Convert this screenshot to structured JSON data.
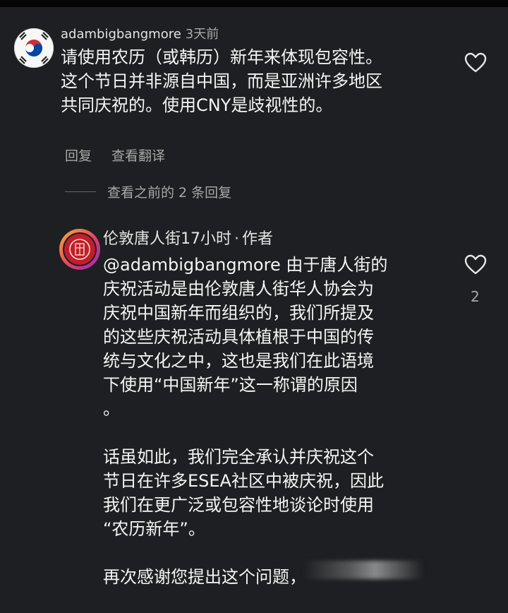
{
  "colors": {
    "background": "#1e1f22",
    "text": "#f2f2f2",
    "muted": "#a8a8a8",
    "korea_flag_red": "#cd2e3a",
    "korea_flag_blue": "#0047a0"
  },
  "comment": {
    "username": "adambigbangmore",
    "time": "3天前",
    "text_lines": [
      "请使用农历（或韩历）新年来体现包容性。",
      "这个节日并非源自中国，而是亚洲许多地区",
      "共同庆祝的。使用CNY是歧视性的。"
    ],
    "avatar_icon": "south-korea-flag-icon",
    "like_icon": "heart-outline-icon"
  },
  "actions": {
    "reply": "回复",
    "translate": "查看翻译"
  },
  "more_replies": "查看之前的 2 条回复",
  "reply": {
    "username": "伦敦唐人街",
    "time": "17小时",
    "separator": "·",
    "author_label": "作者",
    "paragraph1_lines": [
      "@adambigbangmore 由于唐人街的",
      "庆祝活动是由伦敦唐人街华人协会为",
      "庆祝中国新年而组织的，我们所提及",
      "的这些庆祝活动具体植根于中国的传",
      "统与文化之中，这也是我们在此语境",
      "下使用“中国新年”这一称谓的原因",
      "。"
    ],
    "paragraph2_lines": [
      "话虽如此，我们完全承认并庆祝这个",
      "节日在许多ESEA社区中被庆祝，因此",
      "我们在更广泛或包容性地谈论时使用",
      "“农历新年”。"
    ],
    "paragraph3": "再次感谢您提出这个问题，",
    "like_count": "2",
    "avatar_icon": "chinatown-seal-icon",
    "like_icon": "heart-outline-icon"
  }
}
